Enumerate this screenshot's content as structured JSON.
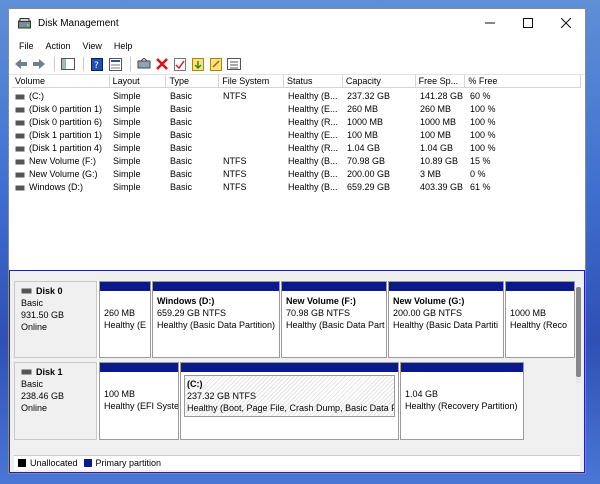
{
  "window": {
    "title": "Disk Management"
  },
  "menu": [
    "File",
    "Action",
    "View",
    "Help"
  ],
  "toolbar_icons": [
    "back-arrow-icon",
    "forward-arrow-icon",
    "sep",
    "console-tree-icon",
    "sep",
    "help-icon",
    "properties-icon",
    "sep",
    "connect-icon",
    "delete-icon",
    "check-icon",
    "import-icon",
    "export-icon",
    "list-icon"
  ],
  "table": {
    "headers": [
      "Volume",
      "Layout",
      "Type",
      "File System",
      "Status",
      "Capacity",
      "Free Sp...",
      "% Free"
    ],
    "rows": [
      [
        "(C:)",
        "Simple",
        "Basic",
        "NTFS",
        "Healthy (B...",
        "237.32 GB",
        "141.28 GB",
        "60 %"
      ],
      [
        "(Disk 0 partition 1)",
        "Simple",
        "Basic",
        "",
        "Healthy (E...",
        "260 MB",
        "260 MB",
        "100 %"
      ],
      [
        "(Disk 0 partition 6)",
        "Simple",
        "Basic",
        "",
        "Healthy (R...",
        "1000 MB",
        "1000 MB",
        "100 %"
      ],
      [
        "(Disk 1 partition 1)",
        "Simple",
        "Basic",
        "",
        "Healthy (E...",
        "100 MB",
        "100 MB",
        "100 %"
      ],
      [
        "(Disk 1 partition 4)",
        "Simple",
        "Basic",
        "",
        "Healthy (R...",
        "1.04 GB",
        "1.04 GB",
        "100 %"
      ],
      [
        "New Volume (F:)",
        "Simple",
        "Basic",
        "NTFS",
        "Healthy (B...",
        "70.98 GB",
        "10.89 GB",
        "15 %"
      ],
      [
        "New Volume (G:)",
        "Simple",
        "Basic",
        "NTFS",
        "Healthy (B...",
        "200.00 GB",
        "3 MB",
        "0 %"
      ],
      [
        "Windows (D:)",
        "Simple",
        "Basic",
        "NTFS",
        "Healthy (B...",
        "659.29 GB",
        "403.39 GB",
        "61 %"
      ]
    ]
  },
  "disks": [
    {
      "name": "Disk 0",
      "type": "Basic",
      "size": "931.50 GB",
      "status": "Online",
      "partitions": [
        {
          "name": "",
          "size": "260 MB",
          "status": "Healthy (E"
        },
        {
          "name": "Windows  (D:)",
          "size": "659.29 GB NTFS",
          "status": "Healthy (Basic Data Partition)"
        },
        {
          "name": "New Volume  (F:)",
          "size": "70.98 GB NTFS",
          "status": "Healthy (Basic Data Part"
        },
        {
          "name": "New Volume  (G:)",
          "size": "200.00 GB NTFS",
          "status": "Healthy (Basic Data Partiti"
        },
        {
          "name": "",
          "size": "1000 MB",
          "status": "Healthy (Reco"
        }
      ]
    },
    {
      "name": "Disk 1",
      "type": "Basic",
      "size": "238.46 GB",
      "status": "Online",
      "partitions": [
        {
          "name": "",
          "size": "100 MB",
          "status": "Healthy (EFI Syste"
        },
        {
          "name": "(C:)",
          "size": "237.32 GB NTFS",
          "status": "Healthy (Boot, Page File, Crash Dump, Basic Data Pa"
        },
        {
          "name": "",
          "size": "1.04 GB",
          "status": "Healthy (Recovery Partition)"
        }
      ]
    }
  ],
  "legend": [
    {
      "label": "Unallocated",
      "color": "#000000"
    },
    {
      "label": "Primary partition",
      "color": "#0b1a8a"
    }
  ],
  "colors": {
    "title_bar_accent": "#9c1a8e",
    "selection_border": "#1c1ccf",
    "partition_header": "#0b1a8a"
  }
}
